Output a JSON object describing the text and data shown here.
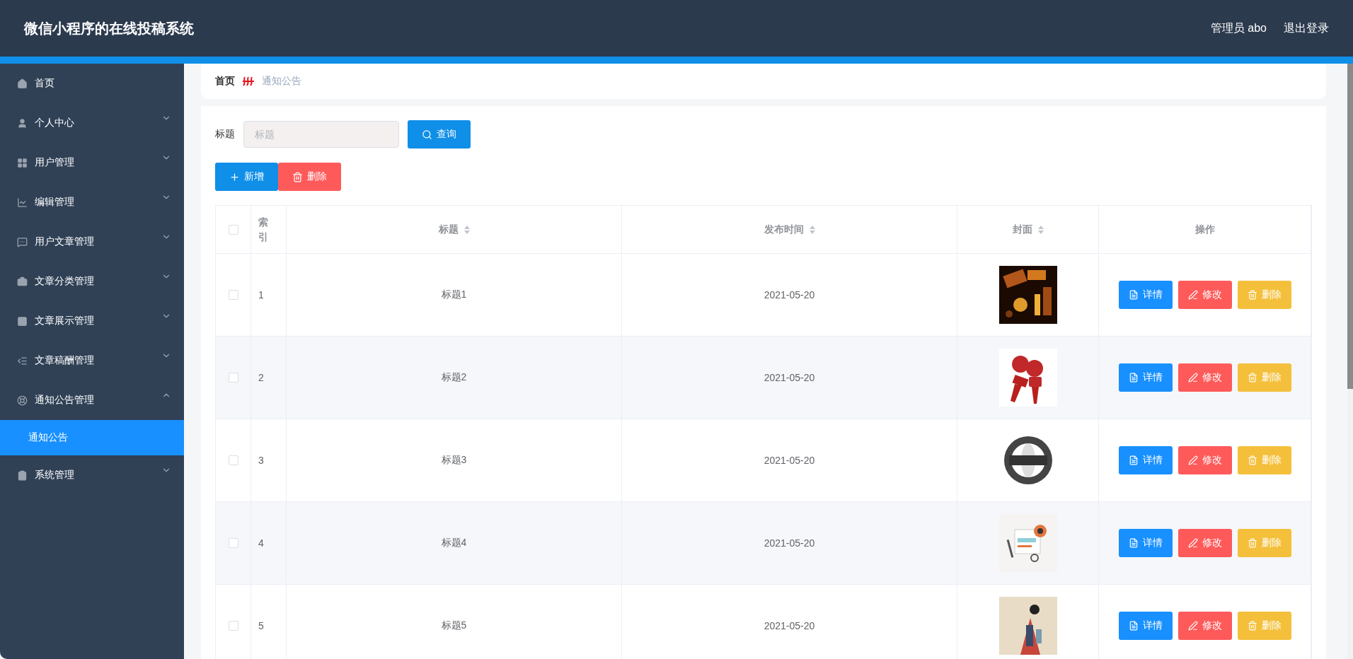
{
  "header": {
    "title": "微信小程序的在线投稿系统",
    "user": "管理员 abo",
    "logout": "退出登录"
  },
  "sidebar": {
    "items": [
      {
        "label": "首页"
      },
      {
        "label": "个人中心",
        "expanded": false
      },
      {
        "label": "用户管理",
        "expanded": false
      },
      {
        "label": "编辑管理",
        "expanded": false
      },
      {
        "label": "用户文章管理",
        "expanded": false
      },
      {
        "label": "文章分类管理",
        "expanded": false
      },
      {
        "label": "文章展示管理",
        "expanded": false
      },
      {
        "label": "文章稿酬管理",
        "expanded": false
      },
      {
        "label": "通知公告管理",
        "expanded": true,
        "children": [
          {
            "label": "通知公告",
            "selected": true
          }
        ]
      },
      {
        "label": "系统管理",
        "expanded": false
      }
    ]
  },
  "breadcrumb": [
    "首页",
    "通知公告"
  ],
  "search": {
    "label": "标题",
    "placeholder": "标题",
    "button": "查询"
  },
  "actions": [
    "新增",
    "删除"
  ],
  "table": {
    "all_checked": false,
    "columns": [
      "索引",
      "标题",
      "发布时间",
      "封面",
      "操作"
    ],
    "rows": [
      {
        "index": "1",
        "title": "标题1",
        "date": "2021-05-20",
        "checked": false,
        "buttons": [
          "详情",
          "修改",
          "删除"
        ]
      },
      {
        "index": "2",
        "title": "标题2",
        "date": "2021-05-20",
        "checked": false,
        "buttons": [
          "详情",
          "修改",
          "删除"
        ]
      },
      {
        "index": "3",
        "title": "标题3",
        "date": "2021-05-20",
        "checked": false,
        "buttons": [
          "详情",
          "修改",
          "删除"
        ]
      },
      {
        "index": "4",
        "title": "标题4",
        "date": "2021-05-20",
        "checked": false,
        "buttons": [
          "详情",
          "修改",
          "删除"
        ]
      },
      {
        "index": "5",
        "title": "标题5",
        "date": "2021-05-20",
        "checked": false,
        "buttons": [
          "详情",
          "修改",
          "删除"
        ]
      }
    ]
  }
}
